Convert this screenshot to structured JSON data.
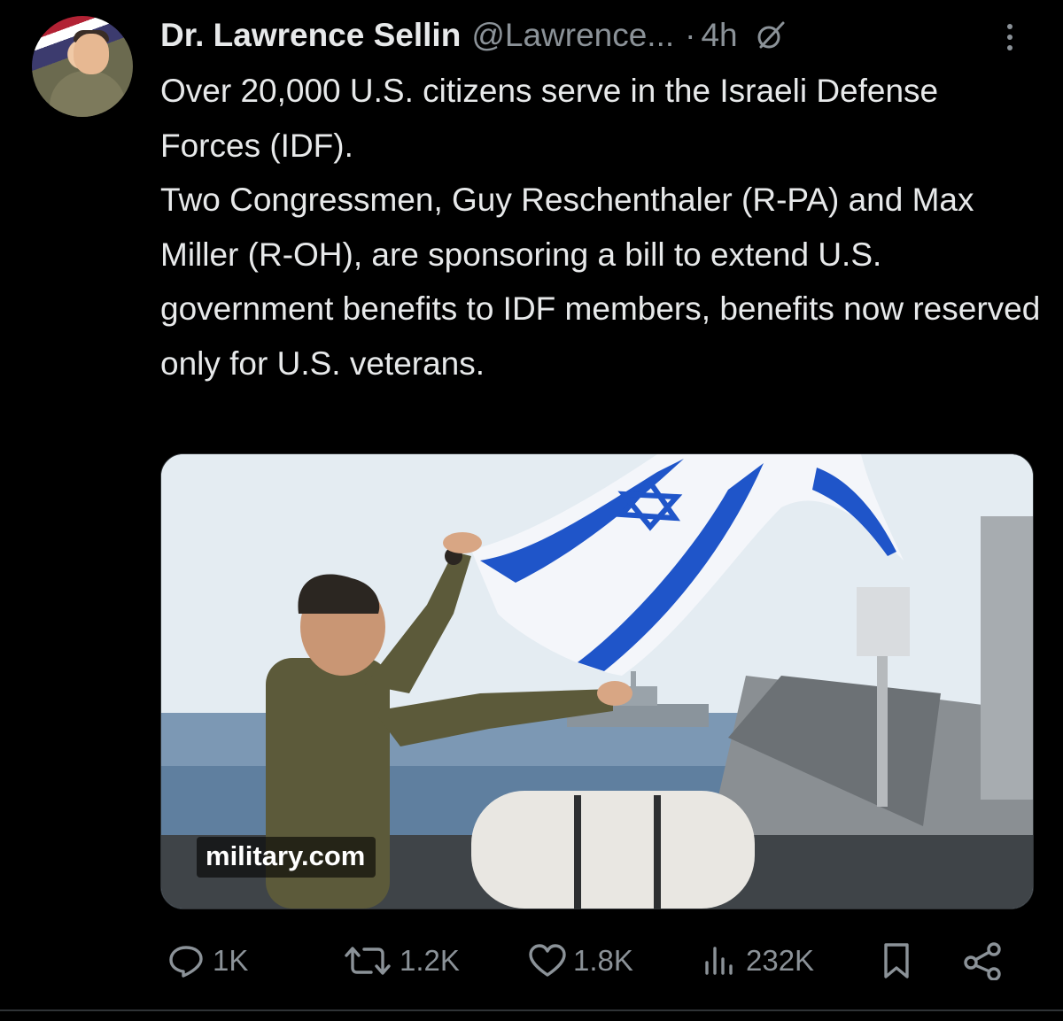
{
  "author": {
    "display_name": "Dr. Lawrence Sellin",
    "handle": "@Lawrence...",
    "separator": "·",
    "time": "4h"
  },
  "tweet": {
    "paragraphs": [
      "Over 20,000 U.S. citizens serve in the Israeli Defense Forces (IDF).",
      "Two Congressmen, Guy Reschenthaler (R-PA) and Max Miller (R-OH), are sponsoring a bill to extend U.S. government benefits to IDF members, benefits now reserved only for U.S. veterans."
    ]
  },
  "media": {
    "source_label": "military.com"
  },
  "actions": {
    "replies": "1K",
    "reposts": "1.2K",
    "likes": "1.8K",
    "views": "232K"
  },
  "icons": [
    "grok-icon",
    "more-icon",
    "reply-icon",
    "repost-icon",
    "like-icon",
    "views-icon",
    "bookmark-icon",
    "share-icon"
  ],
  "colors": {
    "background": "#000000",
    "text": "#e7e9ea",
    "secondary": "#8b9298",
    "flag_blue": "#1f55c9"
  }
}
